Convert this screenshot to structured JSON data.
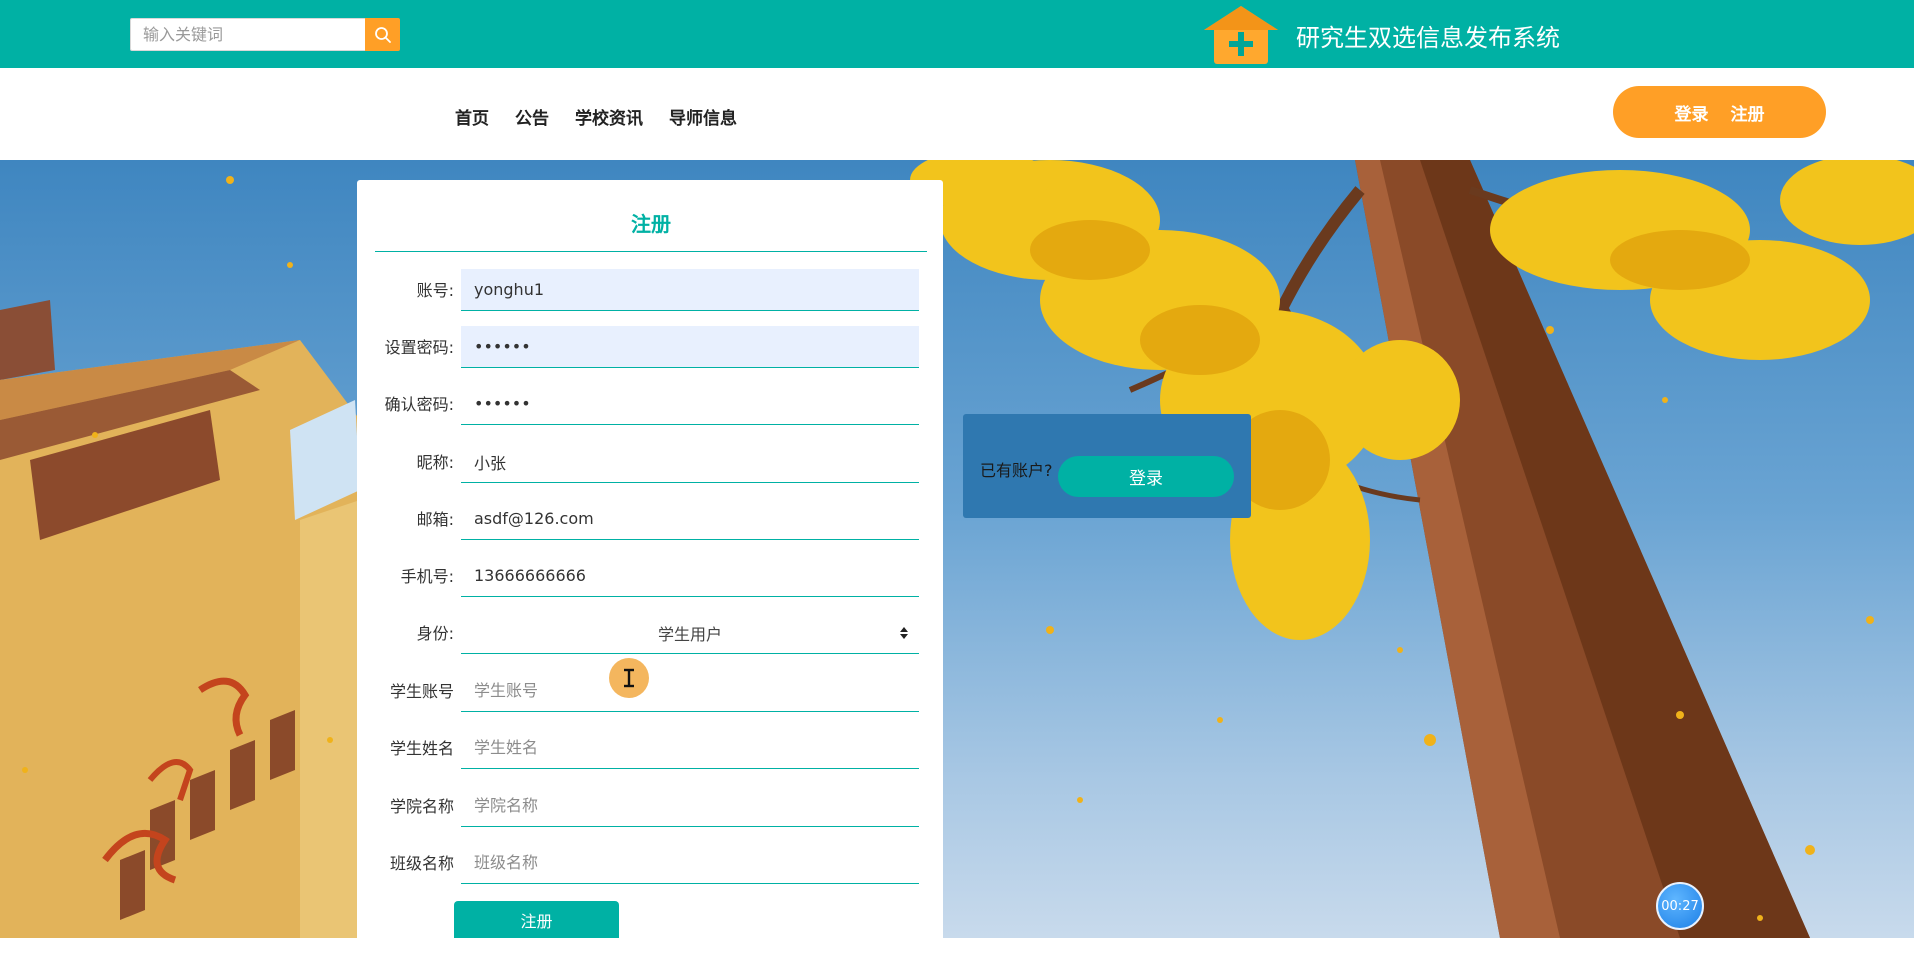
{
  "topbar": {
    "search": {
      "placeholder": "输入关键词"
    },
    "site_title": "研究生双选信息发布系统"
  },
  "nav": {
    "items": [
      {
        "label": "首页"
      },
      {
        "label": "公告"
      },
      {
        "label": "学校资讯"
      },
      {
        "label": "导师信息"
      }
    ],
    "login_label": "登录",
    "register_label": "注册"
  },
  "register_form": {
    "title": "注册",
    "fields": [
      {
        "label": "账号:",
        "value": "yonghu1",
        "placeholder": ""
      },
      {
        "label": "设置密码:",
        "value": "••••••",
        "placeholder": ""
      },
      {
        "label": "确认密码:",
        "value": "••••••",
        "placeholder": ""
      },
      {
        "label": "昵称:",
        "value": "小张",
        "placeholder": ""
      },
      {
        "label": "邮箱:",
        "value": "asdf@126.com",
        "placeholder": ""
      },
      {
        "label": "手机号:",
        "value": "13666666666",
        "placeholder": ""
      }
    ],
    "identity": {
      "label": "身份:",
      "selected": "学生用户"
    },
    "extra_fields": [
      {
        "label": "学生账号",
        "placeholder": "学生账号"
      },
      {
        "label": "学生姓名",
        "placeholder": "学生姓名"
      },
      {
        "label": "学院名称",
        "placeholder": "学院名称"
      },
      {
        "label": "班级名称",
        "placeholder": "班级名称"
      }
    ],
    "submit_label": "注册"
  },
  "login_prompt": {
    "hint": "已有账户?",
    "button_label": "登录"
  },
  "timer": {
    "value": "00:27"
  },
  "colors": {
    "primary": "#00b1a4",
    "accent": "#ff9f26",
    "login_panel": "#2f78b0"
  },
  "icons": {
    "search": "search-icon",
    "logo": "house-plus-logo",
    "cursor": "text-cursor-icon"
  }
}
